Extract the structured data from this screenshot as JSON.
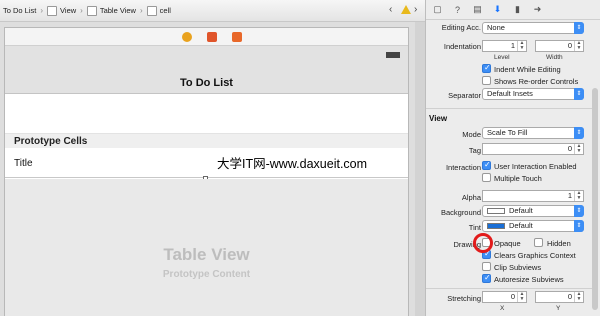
{
  "jumpbar": {
    "crumbs": [
      "To Do List",
      "View",
      "Table View",
      "cell"
    ]
  },
  "canvas": {
    "nav_title": "To Do List",
    "section_header": "Prototype Cells",
    "cell_title": "Title",
    "table_placeholder_title": "Table View",
    "table_placeholder_subtitle": "Prototype Content",
    "watermark": "大学IT网-www.daxueit.com"
  },
  "inspector": {
    "editing_acc_label": "Editing Acc.",
    "editing_acc_value": "None",
    "indentation_label": "Indentation",
    "indentation_level": "1",
    "indentation_width": "0",
    "level_label": "Level",
    "width_label": "Width",
    "indent_while_editing": "Indent While Editing",
    "shows_reorder": "Shows Re-order Controls",
    "separator_label": "Separator",
    "separator_value": "Default Insets",
    "view_section": "View",
    "mode_label": "Mode",
    "mode_value": "Scale To Fill",
    "tag_label": "Tag",
    "tag_value": "0",
    "interaction_label": "Interaction",
    "user_interaction": "User Interaction Enabled",
    "multiple_touch": "Multiple Touch",
    "alpha_label": "Alpha",
    "alpha_value": "1",
    "background_label": "Background",
    "background_value": "Default",
    "tint_label": "Tint",
    "tint_value": "Default",
    "drawing_label": "Drawing",
    "opaque": "Opaque",
    "hidden": "Hidden",
    "clears_graphics": "Clears Graphics Context",
    "clip_subviews": "Clip Subviews",
    "autoresize_subviews": "Autoresize Subviews",
    "stretching_label": "Stretching",
    "stretch_x": "0",
    "stretch_y": "0",
    "x_label": "X",
    "y_label": "Y"
  },
  "colors": {
    "accent": "#3d8ef5",
    "highlight_circle": "#e21b1b",
    "tint_swatch": "#1a6fd6",
    "warning": "#e8b91c"
  },
  "icons": [
    "storyboard-icon",
    "view-icon",
    "table-view-icon",
    "cell-icon",
    "warning-icon",
    "file-icon",
    "help-icon",
    "identity-icon",
    "attributes-icon",
    "size-icon",
    "connections-icon"
  ]
}
